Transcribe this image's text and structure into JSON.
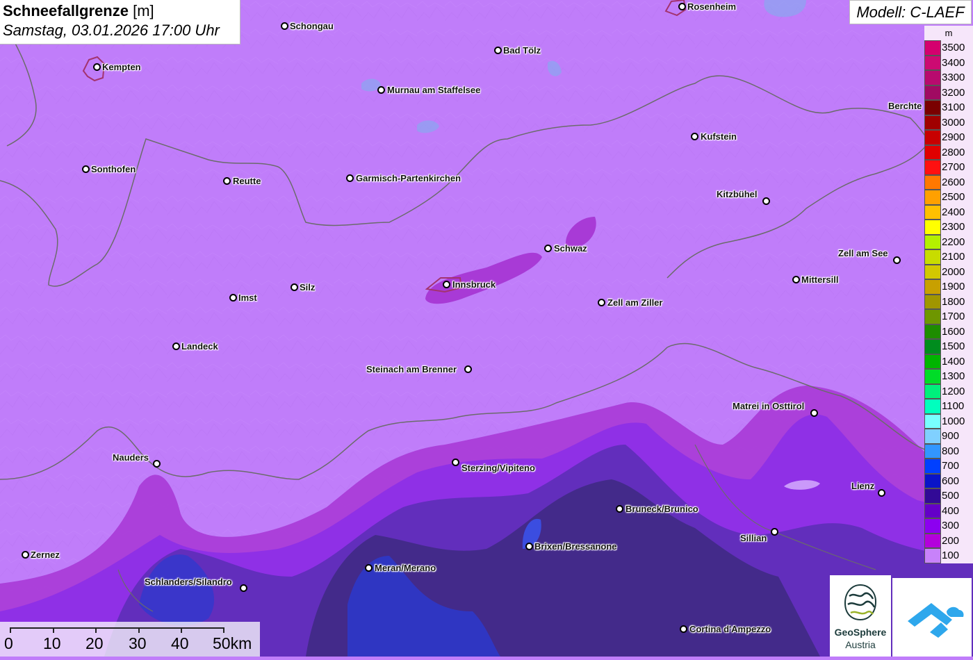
{
  "title": {
    "bold": "Schneefallgrenze",
    "unit": "[m]",
    "datetime": "Samstag, 03.01.2026 17:00 Uhr"
  },
  "model": "Modell: C-LAEF",
  "legend": {
    "unit": "m",
    "entries": [
      {
        "value": "3500",
        "color": "#d4006e"
      },
      {
        "value": "3400",
        "color": "#cc0a72"
      },
      {
        "value": "3300",
        "color": "#b80a6e"
      },
      {
        "value": "3200",
        "color": "#a00a62"
      },
      {
        "value": "3100",
        "color": "#7a0000"
      },
      {
        "value": "3000",
        "color": "#a00000"
      },
      {
        "value": "2900",
        "color": "#c80000"
      },
      {
        "value": "2800",
        "color": "#e00000"
      },
      {
        "value": "2700",
        "color": "#ff1010"
      },
      {
        "value": "2600",
        "color": "#ff7800"
      },
      {
        "value": "2500",
        "color": "#ffa000"
      },
      {
        "value": "2400",
        "color": "#ffc000"
      },
      {
        "value": "2300",
        "color": "#ffff00"
      },
      {
        "value": "2200",
        "color": "#b4f000"
      },
      {
        "value": "2100",
        "color": "#c8dc00"
      },
      {
        "value": "2000",
        "color": "#d2c800"
      },
      {
        "value": "1900",
        "color": "#c8a000"
      },
      {
        "value": "1800",
        "color": "#a09600"
      },
      {
        "value": "1700",
        "color": "#6e9600"
      },
      {
        "value": "1600",
        "color": "#1e8c00"
      },
      {
        "value": "1500",
        "color": "#008c1e"
      },
      {
        "value": "1400",
        "color": "#00b400"
      },
      {
        "value": "1300",
        "color": "#00dc28"
      },
      {
        "value": "1200",
        "color": "#00f07c"
      },
      {
        "value": "1100",
        "color": "#00ffbe"
      },
      {
        "value": "1000",
        "color": "#78ffff"
      },
      {
        "value": "900",
        "color": "#80d0ff"
      },
      {
        "value": "800",
        "color": "#3296ff"
      },
      {
        "value": "700",
        "color": "#0040ff"
      },
      {
        "value": "600",
        "color": "#0a14c8"
      },
      {
        "value": "500",
        "color": "#320a96"
      },
      {
        "value": "400",
        "color": "#6400c8"
      },
      {
        "value": "300",
        "color": "#8c00f0"
      },
      {
        "value": "200",
        "color": "#b400dc"
      },
      {
        "value": "100",
        "color": "#c882fa"
      }
    ]
  },
  "cities": [
    {
      "name": "Rosenheim"
    },
    {
      "name": "Schongau"
    },
    {
      "name": "Bad Tölz"
    },
    {
      "name": "Kempten"
    },
    {
      "name": "Murnau am Staffelsee"
    },
    {
      "name": "Berchte"
    },
    {
      "name": "Kufstein"
    },
    {
      "name": "Sonthofen"
    },
    {
      "name": "Reutte"
    },
    {
      "name": "Garmisch-Partenkirchen"
    },
    {
      "name": "Kitzbühel"
    },
    {
      "name": "Schwaz"
    },
    {
      "name": "Zell am See"
    },
    {
      "name": "Mittersill"
    },
    {
      "name": "Innsbruck"
    },
    {
      "name": "Silz"
    },
    {
      "name": "Imst"
    },
    {
      "name": "Zell am Ziller"
    },
    {
      "name": "Landeck"
    },
    {
      "name": "Steinach am Brenner"
    },
    {
      "name": "Matrei in Osttirol"
    },
    {
      "name": "Nauders"
    },
    {
      "name": "Sterzing/Vipiteno"
    },
    {
      "name": "Lienz"
    },
    {
      "name": "Bruneck/Brunico"
    },
    {
      "name": "Sillian"
    },
    {
      "name": "Brixen/Bressanone"
    },
    {
      "name": "Zernez"
    },
    {
      "name": "Meran/Merano"
    },
    {
      "name": "Schlanders/Silandro"
    },
    {
      "name": "Cortina d'Ampezzo"
    }
  ],
  "scale_bar": {
    "labels": [
      "0",
      "10",
      "20",
      "30",
      "40",
      "50km"
    ]
  },
  "logos": {
    "geosphere_name": "GeoSphere",
    "geosphere_sub": "Austria"
  },
  "colors": {
    "base_fill": "#c07dfa",
    "band_200": "#a83ad6",
    "band_300": "#8a2ee8",
    "band_400": "#5a2eb4",
    "band_500": "#3a2a7a",
    "band_600": "#2a3ad0",
    "borders": "#6b6b6b"
  }
}
